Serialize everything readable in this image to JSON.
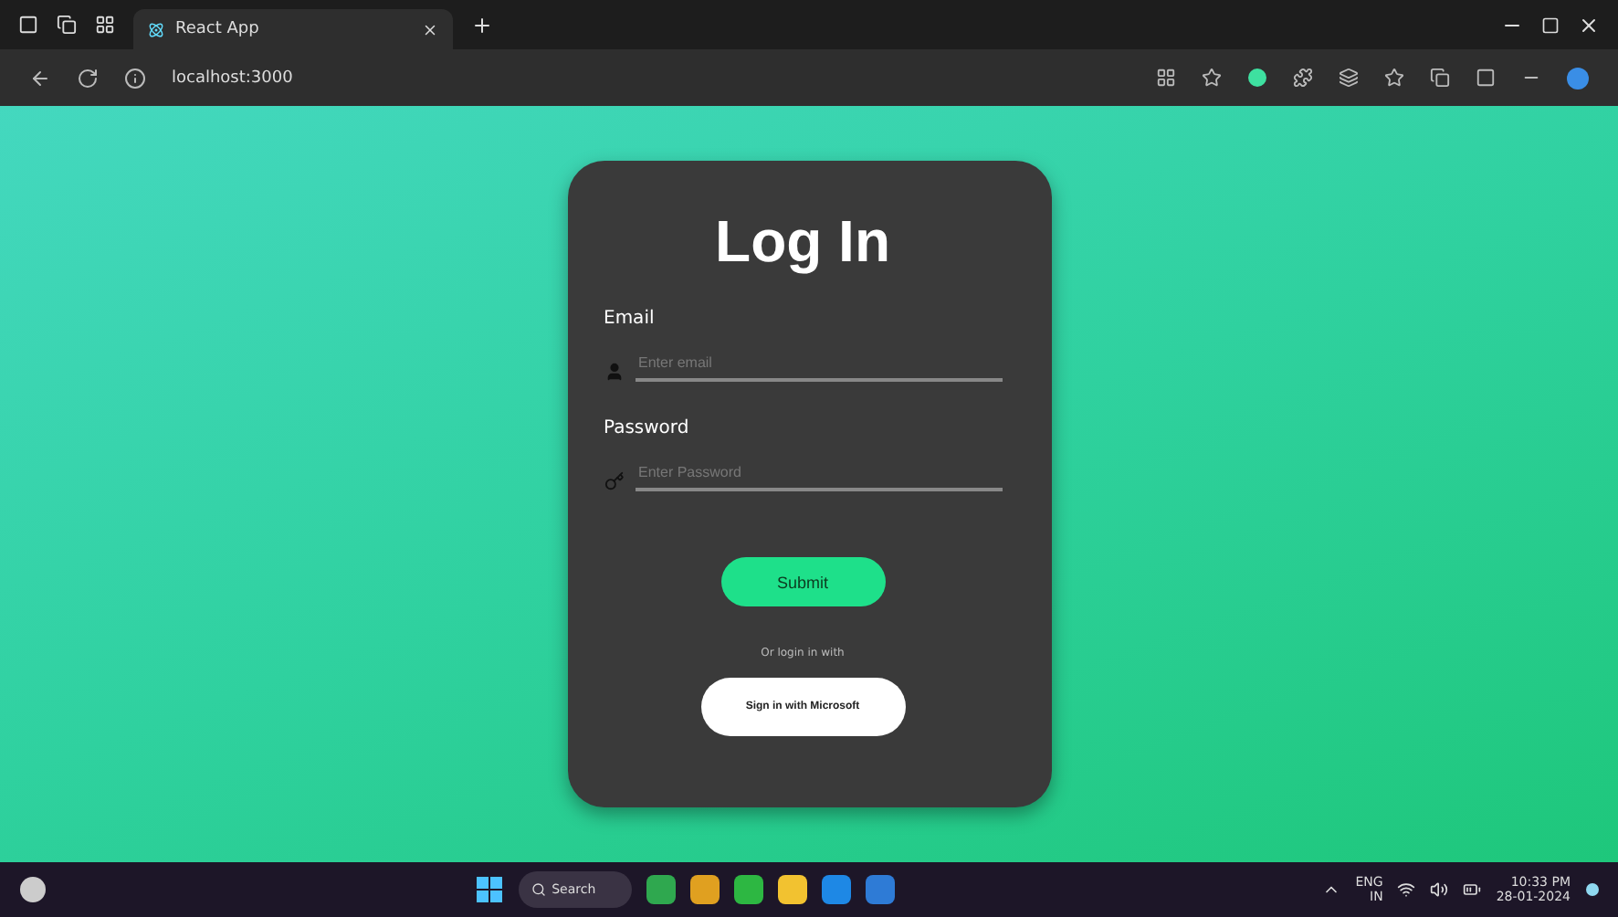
{
  "browser": {
    "tabs": [
      {
        "title": "React App",
        "selected": true
      }
    ],
    "address": "localhost:3000"
  },
  "login": {
    "title": "Log In",
    "fields": [
      {
        "label": "Email",
        "placeholder": "Enter email",
        "kind": "user"
      },
      {
        "label": "Password",
        "placeholder": "Enter Password",
        "kind": "key"
      }
    ],
    "submit": "Submit",
    "divider_text": "Or login in with",
    "microsoft_button": "Sign in with Microsoft"
  },
  "taskbar": {
    "search": "Search",
    "language": "ENG",
    "region": "IN",
    "time": "10:33 PM",
    "date": "28-01-2024"
  }
}
